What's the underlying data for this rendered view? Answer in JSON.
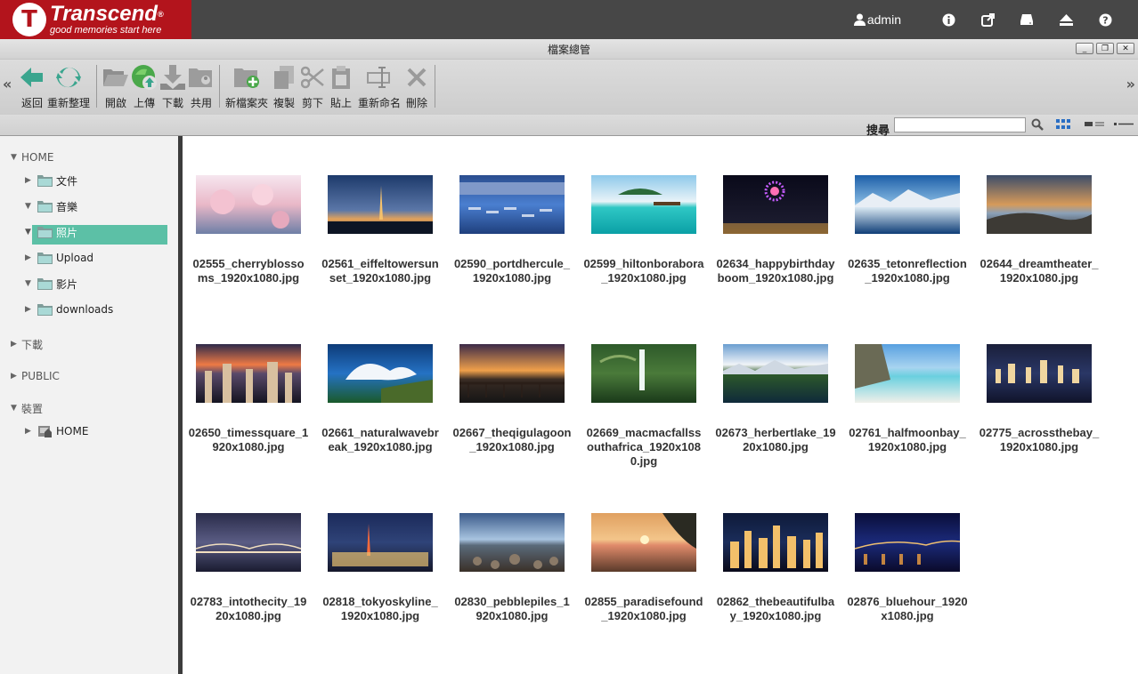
{
  "brand": {
    "name": "Transcend",
    "reg": "®",
    "tagline": "good memories start here",
    "mark": "T",
    "color": "#b3141c"
  },
  "topbar": {
    "username": "admin",
    "icons": [
      "user-icon",
      "info-icon",
      "external-link-icon",
      "drive-icon",
      "eject-icon",
      "help-icon"
    ]
  },
  "window": {
    "title": "檔案總管",
    "controls": [
      "_",
      "❐",
      "✕"
    ]
  },
  "toolbar": {
    "left_arrow": "«",
    "right_arrow": "»",
    "buttons": [
      {
        "label": "返回",
        "icon": "back-icon"
      },
      {
        "label": "重新整理",
        "icon": "refresh-icon"
      },
      {
        "label": "開啟",
        "icon": "open-folder-icon"
      },
      {
        "label": "上傳",
        "icon": "upload-icon"
      },
      {
        "label": "下載",
        "icon": "download-icon"
      },
      {
        "label": "共用",
        "icon": "share-icon"
      },
      {
        "label": "新檔案夾",
        "icon": "new-folder-icon"
      },
      {
        "label": "複製",
        "icon": "copy-icon"
      },
      {
        "label": "剪下",
        "icon": "cut-icon"
      },
      {
        "label": "貼上",
        "icon": "paste-icon"
      },
      {
        "label": "重新命名",
        "icon": "rename-icon"
      },
      {
        "label": "刪除",
        "icon": "delete-icon"
      }
    ]
  },
  "search": {
    "label": "搜尋",
    "value": "",
    "placeholder": ""
  },
  "tree": [
    {
      "label": "HOME",
      "level": 0,
      "expanded": true
    },
    {
      "label": "文件",
      "level": 1,
      "expanded": false
    },
    {
      "label": "音樂",
      "level": 1,
      "expanded": true
    },
    {
      "label": "照片",
      "level": 1,
      "expanded": true,
      "selected": true
    },
    {
      "label": "Upload",
      "level": 1,
      "expanded": false
    },
    {
      "label": "影片",
      "level": 1,
      "expanded": true
    },
    {
      "label": "downloads",
      "level": 1,
      "expanded": false
    },
    {
      "label": "下載",
      "level": 0,
      "expanded": false
    },
    {
      "label": "PUBLIC",
      "level": 0,
      "expanded": false
    },
    {
      "label": "裝置",
      "level": 0,
      "expanded": true
    },
    {
      "label": "HOME",
      "level": 1,
      "expanded": false,
      "device": true
    }
  ],
  "files": [
    {
      "name": "02555_cherryblossoms_1920x1080.jpg",
      "theme": "cherry"
    },
    {
      "name": "02561_eiffeltowersunset_1920x1080.jpg",
      "theme": "eiffel"
    },
    {
      "name": "02590_portdhercule_1920x1080.jpg",
      "theme": "port"
    },
    {
      "name": "02599_hiltonborabora_1920x1080.jpg",
      "theme": "bora"
    },
    {
      "name": "02634_happybirthdayboom_1920x1080.jpg",
      "theme": "fireworks"
    },
    {
      "name": "02635_tetonreflection_1920x1080.jpg",
      "theme": "teton"
    },
    {
      "name": "02644_dreamtheater_1920x1080.jpg",
      "theme": "dream"
    },
    {
      "name": "02650_timessquare_1920x1080.jpg",
      "theme": "times"
    },
    {
      "name": "02661_naturalwavebreak_1920x1080.jpg",
      "theme": "wave"
    },
    {
      "name": "02667_theqigulagoon_1920x1080.jpg",
      "theme": "lagoon"
    },
    {
      "name": "02669_macmacfallssouthafrica_1920x1080.jpg",
      "theme": "falls"
    },
    {
      "name": "02673_herbertlake_1920x1080.jpg",
      "theme": "lake"
    },
    {
      "name": "02761_halfmoonbay_1920x1080.jpg",
      "theme": "halfmoon"
    },
    {
      "name": "02775_acrossthebay_1920x1080.jpg",
      "theme": "bay"
    },
    {
      "name": "02783_intothecity_1920x1080.jpg",
      "theme": "bridge"
    },
    {
      "name": "02818_tokyoskyline_1920x1080.jpg",
      "theme": "tokyo"
    },
    {
      "name": "02830_pebblepiles_1920x1080.jpg",
      "theme": "pebble"
    },
    {
      "name": "02855_paradisefound_1920x1080.jpg",
      "theme": "paradise"
    },
    {
      "name": "02862_thebeautifulbay_1920x1080.jpg",
      "theme": "citybay"
    },
    {
      "name": "02876_bluehour_1920x1080.jpg",
      "theme": "bluehour"
    }
  ]
}
